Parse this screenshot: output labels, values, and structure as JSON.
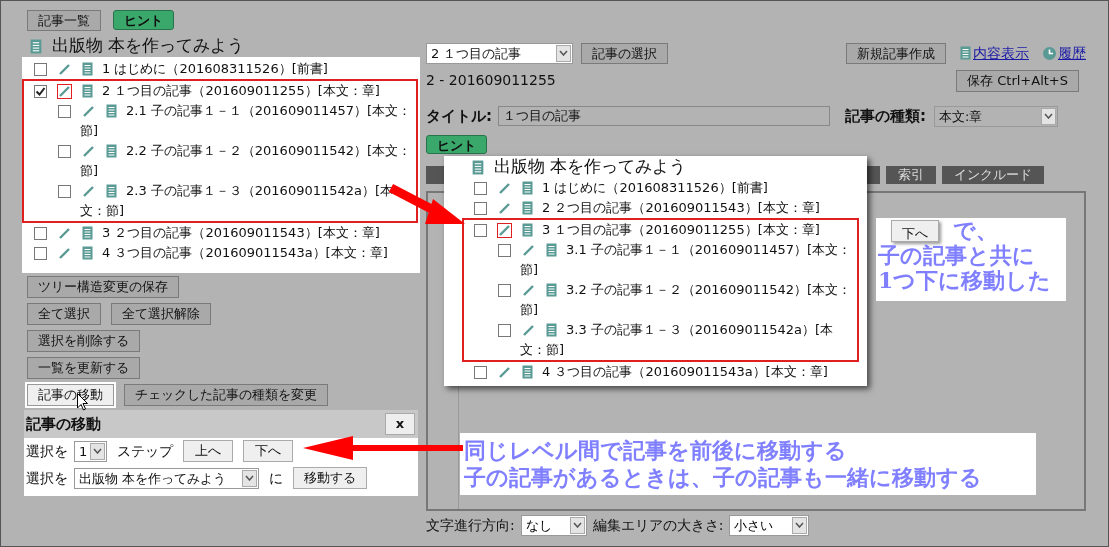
{
  "top_buttons": [
    {
      "label": "記事一覧",
      "kind": "plain"
    },
    {
      "label": "ヒント",
      "kind": "hint"
    }
  ],
  "publication_title": "出版物 本を作ってみよう",
  "tree": [
    {
      "label": "1 はじめに（201608311526）[前書]",
      "checked": false,
      "current": false,
      "annotated": false
    },
    {
      "label": "2 １つ目の記事（201609011255）[本文：章]",
      "checked": true,
      "current": true,
      "annotated": true,
      "children": [
        {
          "label": "2.1 子の記事１－１（201609011457）[本文：節]",
          "checked": false,
          "current": false,
          "annotated": false
        },
        {
          "label": "2.2 子の記事１－２（201609011542）[本文：節]",
          "checked": false,
          "current": false,
          "annotated": false
        },
        {
          "label": "2.3 子の記事１－３（201609011542a）[本文：節]",
          "checked": false,
          "current": false,
          "annotated": false
        }
      ]
    },
    {
      "label": "3 ２つ目の記事（201609011543）[本文：章]",
      "checked": false,
      "current": false,
      "annotated": false
    },
    {
      "label": "4 ３つ目の記事（201609011543a）[本文：章]",
      "checked": false,
      "current": false,
      "annotated": false
    }
  ],
  "action_rows": [
    [
      {
        "label": "ツリー構造変更の保存",
        "active": false
      }
    ],
    [
      {
        "label": "全て選択",
        "active": false
      },
      {
        "label": "全て選択解除",
        "active": false
      }
    ],
    [
      {
        "label": "選択を削除する",
        "active": false
      }
    ],
    [
      {
        "label": "一覧を更新する",
        "active": false
      }
    ],
    [
      {
        "label": "記事の移動",
        "active": true
      },
      {
        "label": "チェックした記事の種類を変更",
        "active": false
      }
    ]
  ],
  "move_panel": {
    "title": "記事の移動",
    "close": "x",
    "step_label": "選択を",
    "step_value": "1",
    "step_unit": "ステップ",
    "up": "上へ",
    "down": "下へ",
    "target_label": "選択を",
    "target_value": "出版物 本を作ってみよう",
    "target_suffix": "に",
    "move": "移動する"
  },
  "editor": {
    "article_select": "2 １つ目の記事",
    "select_button": "記事の選択",
    "new_button": "新規記事作成",
    "links": [
      {
        "label": "内容表示",
        "kind": "doc"
      },
      {
        "label": "履歴",
        "kind": "clock"
      }
    ],
    "article_id": "2 - 201609011255",
    "save_button": "保存 Ctrl+Alt+S",
    "title_label": "タイトル:",
    "title_value": "１つ目の記事",
    "type_label": "記事の種類:",
    "type_value": "本文:章",
    "hint_button": "ヒント",
    "tabs": [
      "索引",
      "インクルード"
    ]
  },
  "footer": {
    "direction_label": "文字進行方向:",
    "direction_value": "なし",
    "size_label": "編集エリアの大きさ:",
    "size_value": "小さい"
  },
  "after_popup": {
    "title": "出版物 本を作ってみよう",
    "tree": [
      {
        "label": "1 はじめに（201608311526）[前書]",
        "checked": false,
        "current": false,
        "annotated": false
      },
      {
        "label": "2 ２つ目の記事（201609011543）[本文：章]",
        "checked": false,
        "current": false,
        "annotated": false
      },
      {
        "label": "3 １つ目の記事（201609011255）[本文：章]",
        "checked": false,
        "current": true,
        "annotated": true,
        "children": [
          {
            "label": "3.1 子の記事１－１（201609011457）[本文：節]",
            "checked": false,
            "current": false,
            "annotated": false
          },
          {
            "label": "3.2 子の記事１－２（201609011542）[本文：節]",
            "checked": false,
            "current": false,
            "annotated": false
          },
          {
            "label": "3.3 子の記事１－３（201609011542a）[本文：節]",
            "checked": false,
            "current": false,
            "annotated": false
          }
        ]
      },
      {
        "label": "4 ３つ目の記事（201609011543a）[本文：章]",
        "checked": false,
        "current": false,
        "annotated": false
      }
    ]
  },
  "callouts": [
    {
      "button": "下へ",
      "lines": [
        "で、",
        "子の記事と共に",
        "1つ下に移動した"
      ]
    },
    {
      "lines": [
        "同じレベル間で記事を前後に移動する",
        "子の記事があるときは、子の記事も一緒に移動する"
      ]
    }
  ]
}
